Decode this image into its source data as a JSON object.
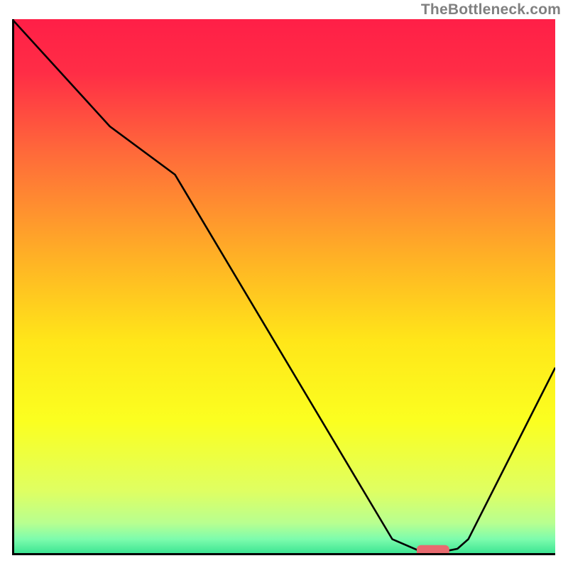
{
  "watermark": "TheBottleneck.com",
  "chart_data": {
    "type": "line",
    "title": "",
    "xlabel": "",
    "ylabel": "",
    "xlim": [
      0,
      100
    ],
    "ylim": [
      0,
      100
    ],
    "grid": false,
    "legend": false,
    "series": [
      {
        "name": "curve",
        "color": "#000000",
        "x": [
          0,
          18,
          30,
          70,
          75,
          80,
          82,
          84,
          100
        ],
        "y": [
          100,
          80,
          71,
          3,
          0.8,
          0.8,
          1.2,
          3,
          35
        ]
      }
    ],
    "marker": {
      "name": "indicator",
      "color": "#e86a6f",
      "x_center": 77.5,
      "y": 0.8,
      "width": 6,
      "height": 2.2
    },
    "background_gradient": {
      "stops": [
        {
          "offset": 0.0,
          "color": "#ff1f47"
        },
        {
          "offset": 0.1,
          "color": "#ff2d46"
        },
        {
          "offset": 0.25,
          "color": "#ff6a3a"
        },
        {
          "offset": 0.45,
          "color": "#ffb325"
        },
        {
          "offset": 0.6,
          "color": "#ffe619"
        },
        {
          "offset": 0.75,
          "color": "#fbff20"
        },
        {
          "offset": 0.88,
          "color": "#dfff62"
        },
        {
          "offset": 0.94,
          "color": "#b8ff90"
        },
        {
          "offset": 0.97,
          "color": "#7dfcad"
        },
        {
          "offset": 1.0,
          "color": "#34e28f"
        }
      ]
    }
  }
}
